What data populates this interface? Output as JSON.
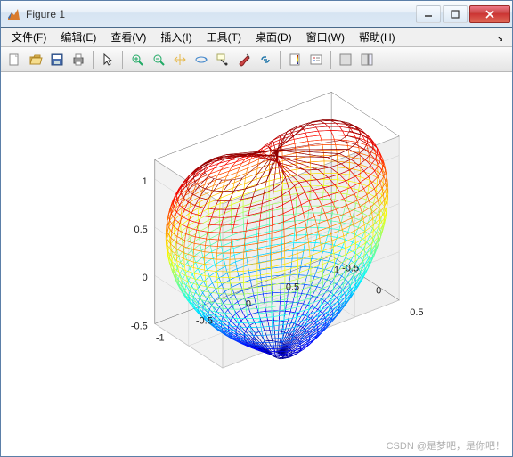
{
  "window": {
    "title": "Figure 1"
  },
  "menu": {
    "file": "文件(F)",
    "edit": "编辑(E)",
    "view": "查看(V)",
    "insert": "插入(I)",
    "tools": "工具(T)",
    "desktop": "桌面(D)",
    "window": "窗口(W)",
    "help": "帮助(H)"
  },
  "toolbar_icons": {
    "new": "new",
    "open": "open",
    "save": "save",
    "print": "print",
    "arrow": "arrow",
    "zoomin": "zoomin",
    "zoomout": "zoomout",
    "pan": "pan",
    "rotate": "rotate",
    "datacursor": "datacursor",
    "brush": "brush",
    "link": "link",
    "colorbar": "colorbar",
    "legend": "legend",
    "hide": "hide",
    "annotate": "annotate"
  },
  "watermark": "CSDN @是梦吧，是你吧！",
  "chart_data": {
    "type": "surface",
    "description": "3D wireframe heart-shaped isosurface (heart equation (x²+9/4 y²+z²-1)³ - x² z³ - 9/80 y² z³ = 0), colored by z with jet colormap",
    "x_range": [
      -1,
      1
    ],
    "y_range": [
      -0.5,
      0.5
    ],
    "z_range": [
      -0.5,
      1.2
    ],
    "x_ticks": [
      -1,
      -0.5,
      0,
      0.5,
      1
    ],
    "y_ticks": [
      -0.5,
      0,
      0.5
    ],
    "z_ticks": [
      -0.5,
      0,
      0.5,
      1
    ],
    "colormap": "jet",
    "color_by": "z",
    "view_azimuth": -37.5,
    "view_elevation": 30,
    "grid": true
  }
}
